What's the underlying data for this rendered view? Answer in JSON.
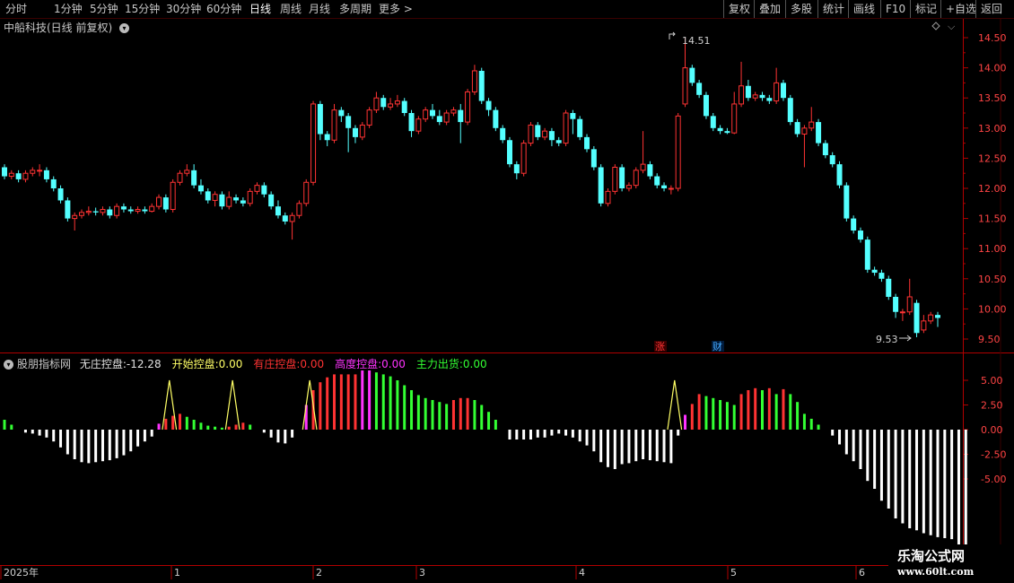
{
  "toolbar": {
    "tabs": [
      "分时",
      "1分钟",
      "5分钟",
      "15分钟",
      "30分钟",
      "60分钟",
      "日线",
      "周线",
      "月线",
      "多周期",
      "更多 >"
    ],
    "active_tab": "日线",
    "right_buttons": [
      "复权",
      "叠加",
      "多股",
      "统计",
      "画线",
      "F10",
      "标记",
      "+自选",
      "返回"
    ]
  },
  "stock": {
    "title": "中船科技(日线 前复权)"
  },
  "price_axis": {
    "ticks": [
      "14.50",
      "14.00",
      "13.50",
      "13.00",
      "12.50",
      "12.00",
      "11.50",
      "11.00",
      "10.50",
      "10.00",
      "9.50"
    ]
  },
  "price_annotations": {
    "high": "14.51",
    "low": "9.53"
  },
  "event_badges": [
    {
      "text": "涨",
      "color": "#ff3333"
    },
    {
      "text": "财",
      "color": "#44aaff"
    }
  ],
  "indicator": {
    "name": "股朋指标网",
    "items": [
      {
        "label": "无庄控盘:",
        "value": "-12.28",
        "color": "#e0e0e0"
      },
      {
        "label": "开始控盘:",
        "value": "0.00",
        "color": "#ffff66"
      },
      {
        "label": "有庄控盘:",
        "value": "0.00",
        "color": "#ff3333"
      },
      {
        "label": "高度控盘:",
        "value": "0.00",
        "color": "#ff33ff"
      },
      {
        "label": "主力出货:",
        "value": "0.00",
        "color": "#33ff33"
      }
    ],
    "axis_ticks": [
      "5.00",
      "2.50",
      "0.00",
      "-2.50",
      "-5.00"
    ]
  },
  "date_axis": {
    "labels": [
      "2025年",
      "1",
      "2",
      "3",
      "4",
      "5",
      "6"
    ]
  },
  "watermark": {
    "line1": "乐淘公式网",
    "line2": "www.60lt.com"
  },
  "colors": {
    "up": "#ff3333",
    "down": "#54ffff",
    "border": "#b00000",
    "white_bar": "#ffffff",
    "green_bar": "#33ff33",
    "magenta_bar": "#ff33ff",
    "yellow_line": "#ffff66"
  },
  "chart_data": {
    "type": "candlestick",
    "ylim": [
      9.4,
      14.6
    ],
    "candles": [
      [
        12.35,
        12.2,
        12.4,
        12.15
      ],
      [
        12.2,
        12.25,
        12.3,
        12.15
      ],
      [
        12.25,
        12.15,
        12.3,
        12.1
      ],
      [
        12.15,
        12.25,
        12.3,
        12.1
      ],
      [
        12.25,
        12.3,
        12.35,
        12.2
      ],
      [
        12.3,
        12.3,
        12.4,
        12.2
      ],
      [
        12.3,
        12.15,
        12.35,
        12.1
      ],
      [
        12.15,
        12.0,
        12.2,
        11.95
      ],
      [
        12.0,
        11.8,
        12.05,
        11.75
      ],
      [
        11.8,
        11.5,
        11.85,
        11.45
      ],
      [
        11.5,
        11.55,
        11.6,
        11.3
      ],
      [
        11.55,
        11.6,
        11.65,
        11.5
      ],
      [
        11.6,
        11.62,
        11.7,
        11.55
      ],
      [
        11.62,
        11.6,
        11.68,
        11.55
      ],
      [
        11.6,
        11.65,
        11.7,
        11.55
      ],
      [
        11.65,
        11.55,
        11.7,
        11.5
      ],
      [
        11.55,
        11.7,
        11.75,
        11.5
      ],
      [
        11.7,
        11.65,
        11.75,
        11.6
      ],
      [
        11.65,
        11.62,
        11.7,
        11.58
      ],
      [
        11.62,
        11.65,
        11.7,
        11.58
      ],
      [
        11.65,
        11.62,
        11.7,
        11.58
      ],
      [
        11.62,
        11.7,
        11.75,
        11.6
      ],
      [
        11.7,
        11.85,
        11.9,
        11.65
      ],
      [
        11.85,
        11.65,
        11.9,
        11.6
      ],
      [
        11.65,
        12.1,
        12.15,
        11.6
      ],
      [
        12.1,
        12.25,
        12.3,
        12.05
      ],
      [
        12.25,
        12.3,
        12.4,
        12.2
      ],
      [
        12.3,
        12.05,
        12.4,
        12.0
      ],
      [
        12.05,
        11.95,
        12.15,
        11.9
      ],
      [
        11.95,
        11.8,
        12.0,
        11.75
      ],
      [
        11.8,
        11.9,
        11.95,
        11.7
      ],
      [
        11.9,
        11.7,
        11.95,
        11.65
      ],
      [
        11.7,
        11.85,
        11.95,
        11.65
      ],
      [
        11.85,
        11.8,
        11.9,
        11.75
      ],
      [
        11.8,
        11.75,
        11.85,
        11.7
      ],
      [
        11.75,
        11.95,
        12.0,
        11.7
      ],
      [
        11.95,
        12.05,
        12.1,
        11.9
      ],
      [
        12.05,
        11.9,
        12.1,
        11.85
      ],
      [
        11.9,
        11.7,
        11.95,
        11.65
      ],
      [
        11.7,
        11.55,
        11.8,
        11.5
      ],
      [
        11.55,
        11.45,
        11.6,
        11.4
      ],
      [
        11.45,
        11.55,
        11.6,
        11.15
      ],
      [
        11.55,
        11.75,
        11.8,
        11.5
      ],
      [
        11.75,
        12.1,
        12.15,
        11.7
      ],
      [
        12.1,
        13.4,
        13.45,
        12.05
      ],
      [
        13.4,
        12.9,
        13.45,
        12.8
      ],
      [
        12.9,
        12.8,
        12.95,
        12.7
      ],
      [
        12.8,
        13.3,
        13.4,
        12.75
      ],
      [
        13.3,
        13.2,
        13.35,
        13.1
      ],
      [
        13.2,
        13.0,
        13.25,
        12.6
      ],
      [
        13.0,
        12.85,
        13.05,
        12.75
      ],
      [
        12.85,
        13.05,
        13.1,
        12.8
      ],
      [
        13.05,
        13.3,
        13.35,
        13.0
      ],
      [
        13.3,
        13.5,
        13.6,
        13.25
      ],
      [
        13.5,
        13.35,
        13.55,
        13.3
      ],
      [
        13.35,
        13.4,
        13.5,
        13.3
      ],
      [
        13.4,
        13.45,
        13.55,
        13.35
      ],
      [
        13.45,
        13.25,
        13.5,
        13.2
      ],
      [
        13.25,
        12.95,
        13.3,
        12.85
      ],
      [
        12.95,
        13.15,
        13.2,
        12.9
      ],
      [
        13.15,
        13.3,
        13.35,
        13.1
      ],
      [
        13.3,
        13.2,
        13.4,
        13.15
      ],
      [
        13.2,
        13.1,
        13.3,
        13.05
      ],
      [
        13.1,
        13.25,
        13.3,
        13.05
      ],
      [
        13.25,
        13.3,
        13.35,
        13.2
      ],
      [
        13.3,
        13.1,
        13.4,
        12.75
      ],
      [
        13.1,
        13.6,
        13.65,
        13.05
      ],
      [
        13.6,
        13.95,
        14.05,
        13.55
      ],
      [
        13.95,
        13.45,
        14.0,
        13.4
      ],
      [
        13.45,
        13.3,
        13.5,
        13.2
      ],
      [
        13.3,
        13.0,
        13.35,
        12.95
      ],
      [
        13.0,
        12.8,
        13.05,
        12.75
      ],
      [
        12.8,
        12.4,
        12.85,
        12.35
      ],
      [
        12.4,
        12.25,
        12.45,
        12.15
      ],
      [
        12.25,
        12.75,
        12.8,
        12.2
      ],
      [
        12.75,
        13.05,
        13.1,
        12.7
      ],
      [
        13.05,
        12.85,
        13.1,
        12.8
      ],
      [
        12.85,
        12.95,
        13.0,
        12.8
      ],
      [
        12.95,
        12.8,
        13.0,
        12.7
      ],
      [
        12.8,
        12.75,
        12.85,
        12.7
      ],
      [
        12.75,
        13.25,
        13.3,
        12.7
      ],
      [
        13.25,
        13.15,
        13.3,
        12.9
      ],
      [
        13.15,
        12.85,
        13.2,
        12.8
      ],
      [
        12.85,
        12.65,
        12.9,
        12.6
      ],
      [
        12.65,
        12.35,
        12.7,
        12.3
      ],
      [
        12.35,
        11.75,
        12.4,
        11.7
      ],
      [
        11.75,
        11.95,
        12.0,
        11.7
      ],
      [
        11.95,
        12.35,
        12.4,
        11.9
      ],
      [
        12.35,
        12.0,
        12.4,
        11.95
      ],
      [
        12.0,
        12.05,
        12.1,
        11.95
      ],
      [
        12.05,
        12.3,
        12.35,
        12.0
      ],
      [
        12.3,
        12.4,
        12.95,
        12.25
      ],
      [
        12.4,
        12.2,
        12.45,
        12.15
      ],
      [
        12.2,
        12.05,
        12.25,
        12.0
      ],
      [
        12.05,
        12.0,
        12.1,
        11.95
      ],
      [
        12.0,
        12.0,
        12.05,
        11.9
      ],
      [
        12.0,
        13.2,
        13.25,
        11.95
      ],
      [
        13.4,
        14.0,
        14.51,
        13.35
      ],
      [
        14.0,
        13.75,
        14.05,
        13.7
      ],
      [
        13.75,
        13.55,
        13.8,
        13.5
      ],
      [
        13.55,
        13.2,
        13.6,
        13.15
      ],
      [
        13.2,
        13.0,
        13.25,
        12.95
      ],
      [
        13.0,
        12.95,
        13.05,
        12.9
      ],
      [
        12.95,
        12.92,
        13.0,
        12.9
      ],
      [
        12.92,
        13.4,
        13.6,
        12.9
      ],
      [
        13.4,
        13.7,
        14.1,
        13.35
      ],
      [
        13.7,
        13.5,
        13.8,
        13.45
      ],
      [
        13.5,
        13.55,
        13.6,
        13.45
      ],
      [
        13.55,
        13.5,
        13.6,
        13.45
      ],
      [
        13.5,
        13.45,
        13.55,
        13.4
      ],
      [
        13.45,
        13.75,
        14.0,
        13.4
      ],
      [
        13.75,
        13.5,
        13.8,
        13.45
      ],
      [
        13.5,
        13.1,
        13.55,
        13.05
      ],
      [
        13.1,
        12.9,
        13.15,
        12.85
      ],
      [
        12.9,
        13.0,
        13.05,
        12.35
      ],
      [
        13.0,
        13.1,
        13.35,
        12.95
      ],
      [
        13.1,
        12.75,
        13.15,
        12.7
      ],
      [
        12.75,
        12.55,
        12.8,
        12.5
      ],
      [
        12.55,
        12.4,
        12.6,
        12.35
      ],
      [
        12.4,
        12.05,
        12.45,
        12.0
      ],
      [
        12.05,
        11.5,
        12.1,
        11.45
      ],
      [
        11.5,
        11.3,
        11.55,
        11.25
      ],
      [
        11.3,
        11.15,
        11.35,
        11.1
      ],
      [
        11.15,
        10.65,
        11.2,
        10.6
      ],
      [
        10.65,
        10.6,
        10.7,
        10.55
      ],
      [
        10.6,
        10.5,
        10.65,
        10.45
      ],
      [
        10.5,
        10.2,
        10.55,
        10.15
      ],
      [
        10.2,
        9.95,
        10.25,
        9.85
      ],
      [
        9.95,
        9.95,
        10.0,
        9.8
      ],
      [
        9.95,
        10.2,
        10.5,
        9.9
      ],
      [
        10.1,
        9.6,
        10.15,
        9.53
      ],
      [
        9.65,
        9.8,
        9.9,
        9.6
      ],
      [
        9.8,
        9.9,
        9.95,
        9.75
      ],
      [
        9.9,
        9.85,
        9.95,
        9.7
      ]
    ],
    "indicator_values": [
      1.0,
      0.5,
      0.0,
      -0.3,
      -0.4,
      -0.6,
      -0.8,
      -1.2,
      -1.8,
      -2.5,
      -3.0,
      -3.3,
      -3.4,
      -3.3,
      -3.2,
      -3.1,
      -2.9,
      -2.6,
      -2.2,
      -1.7,
      -1.2,
      -0.7,
      0.6,
      1.1,
      1.4,
      1.6,
      1.3,
      1.0,
      0.7,
      0.4,
      0.3,
      0.2,
      0.3,
      0.5,
      0.7,
      0.5,
      0.0,
      -0.3,
      -0.8,
      -1.3,
      -1.4,
      -0.8,
      0.0,
      2.5,
      4.0,
      4.8,
      5.3,
      5.6,
      5.6,
      5.6,
      5.6,
      6.0,
      6.0,
      5.8,
      5.6,
      5.4,
      5.0,
      4.5,
      4.0,
      3.5,
      3.2,
      3.0,
      2.8,
      2.6,
      3.0,
      3.2,
      3.2,
      3.0,
      2.5,
      1.8,
      1.0,
      0.0,
      -1.0,
      -1.0,
      -1.0,
      -1.0,
      -0.8,
      -0.8,
      -0.6,
      -0.4,
      -0.6,
      -0.8,
      -1.2,
      -1.6,
      -2.2,
      -3.3,
      -3.8,
      -4.0,
      -3.5,
      -3.4,
      -3.2,
      -3.0,
      -3.1,
      -3.2,
      -3.3,
      -3.4,
      -0.6,
      1.5,
      2.6,
      3.6,
      3.4,
      3.2,
      3.0,
      2.8,
      2.5,
      3.6,
      4.0,
      4.2,
      4.0,
      4.2,
      3.6,
      4.1,
      3.6,
      2.8,
      1.6,
      1.1,
      0.5,
      0.0,
      -0.6,
      -1.5,
      -2.5,
      -3.2,
      -4.0,
      -5.2,
      -6.0,
      -7.2,
      -8.0,
      -9.0,
      -9.5,
      -10.0,
      -10.2,
      -10.5,
      -10.7,
      -10.9,
      -11.0,
      -11.1,
      -12.0,
      -12.28
    ],
    "indicator_ylim": [
      -13,
      7
    ]
  }
}
